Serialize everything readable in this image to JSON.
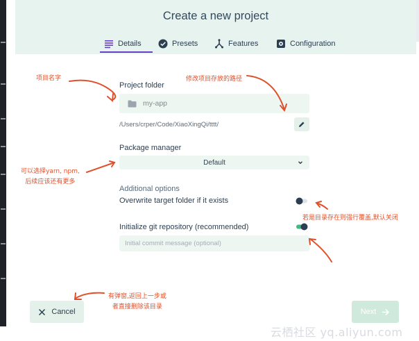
{
  "window": {
    "title": "Create a new project",
    "tabs": [
      {
        "label": "Details",
        "icon": "list-icon",
        "active": true
      },
      {
        "label": "Presets",
        "icon": "check-circle-icon",
        "active": false
      },
      {
        "label": "Features",
        "icon": "fork-icon",
        "active": false
      },
      {
        "label": "Configuration",
        "icon": "gear-icon",
        "active": false
      }
    ]
  },
  "form": {
    "project_folder": {
      "label": "Project folder",
      "value": "my-app",
      "path": "/Users/crper/Code/XiaoXingQi/tttt/"
    },
    "package_manager": {
      "label": "Package manager",
      "selected": "Default"
    },
    "additional_options": {
      "heading": "Additional options",
      "overwrite_label": "Overwrite target folder if it exists",
      "overwrite_on": false,
      "git_label": "Initialize git repository (recommended)",
      "git_on": true,
      "commit_placeholder": "Initial commit message (optional)"
    }
  },
  "footer": {
    "cancel_label": "Cancel",
    "next_label": "Next"
  },
  "annotations": {
    "project_name": "项目名字",
    "change_path": "修改项目存放的路径",
    "package_line1": "可以选择yarn, npm,",
    "package_line2": "后续应该还有更多",
    "overwrite_note": "若是目录存在则强行覆盖,默认关闭",
    "cancel_line1": "有弹窗,返回上一步或",
    "cancel_line2": "者直接删除该目录"
  },
  "watermark": "云栖社区 yq.aliyun.com",
  "colors": {
    "header_bg": "#e6f3ee",
    "accent_green": "#42b983",
    "tab_underline": "#6a3fc8",
    "annotation": "#e0502b",
    "field_bg": "#eef6f2"
  }
}
